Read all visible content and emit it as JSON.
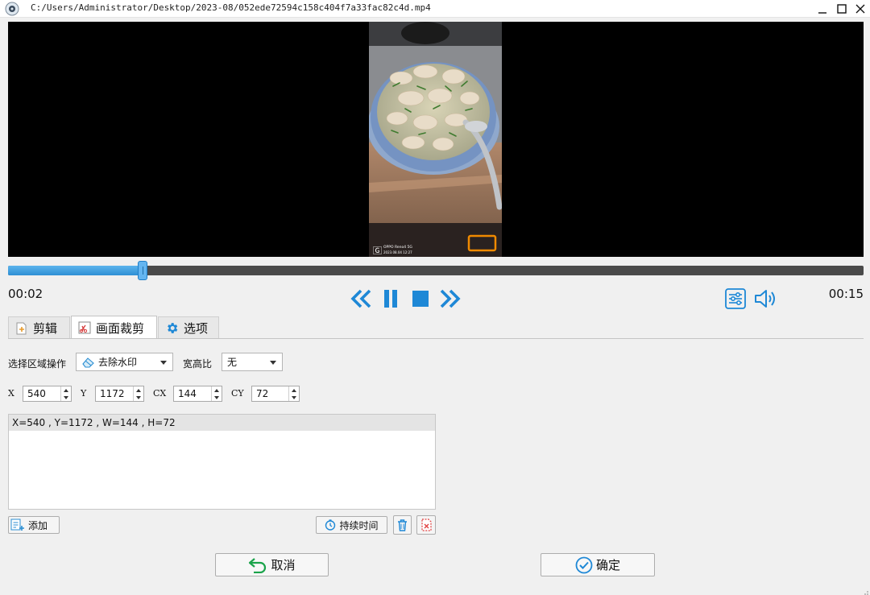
{
  "window": {
    "title": "C:/Users/Administrator/Desktop/2023-08/052ede72594c158c404f7a33fac82c4d.mp4"
  },
  "video": {
    "overlay_brand": "OPPO Reno4 5G",
    "overlay_date": "2023.08.04 12:27"
  },
  "player": {
    "current_time": "00:02",
    "total_time": "00:15",
    "progress": 0.157
  },
  "tabs": [
    {
      "label": "剪辑",
      "icon": "clip-icon"
    },
    {
      "label": "画面裁剪",
      "icon": "crop-icon"
    },
    {
      "label": "选项",
      "icon": "gear-icon"
    }
  ],
  "active_tab": 1,
  "crop": {
    "region_op_label": "选择区域操作",
    "region_op_value": "去除水印",
    "aspect_label": "宽高比",
    "aspect_value": "无",
    "x_label": "X",
    "x_value": "540",
    "y_label": "Y",
    "y_value": "1172",
    "cx_label": "CX",
    "cx_value": "144",
    "cy_label": "CY",
    "cy_value": "72",
    "regions": [
      "X=540 , Y=1172 , W=144 , H=72"
    ]
  },
  "buttons": {
    "add": "添加",
    "duration": "持续时间",
    "cancel": "取消",
    "confirm": "确定"
  },
  "colors": {
    "accent": "#1e88d6",
    "delete_red": "#e04040",
    "watermark_box": "#f08a00"
  }
}
